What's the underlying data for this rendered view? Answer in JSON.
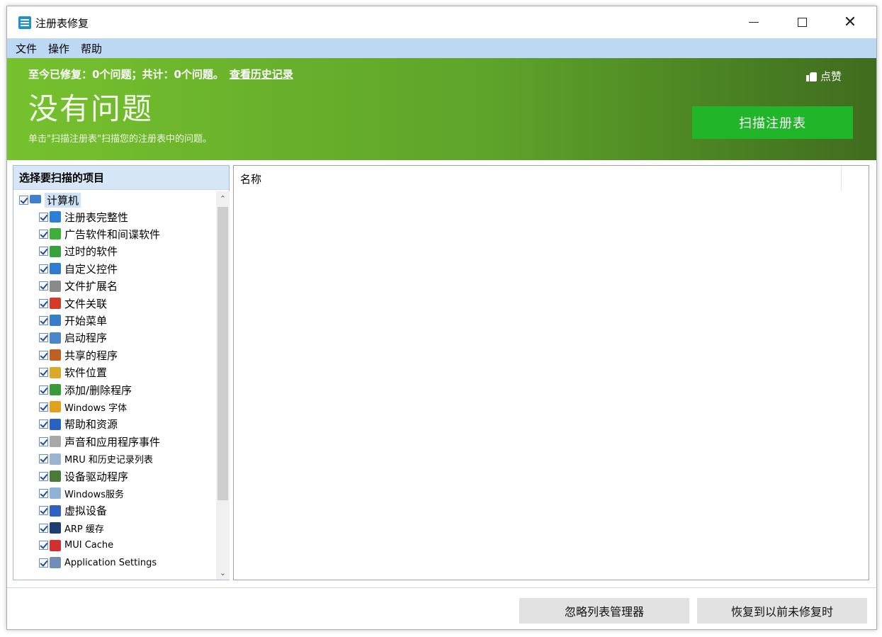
{
  "window": {
    "title": "注册表修复"
  },
  "menu": {
    "items": [
      "文件",
      "操作",
      "帮助"
    ]
  },
  "banner": {
    "stats_text": "至今已修复：0个问题；共计：0个问题。",
    "history_link": "查看历史记录",
    "title": "没有问题",
    "hint": "单击\"扫描注册表\"扫描您的注册表中的问题。",
    "like_label": "点赞",
    "scan_button": "扫描注册表",
    "colors": {
      "start": "#76c12e",
      "end": "#3f6c1e",
      "button": "#21b62a"
    }
  },
  "left_panel": {
    "header": "选择要扫描的项目",
    "root": {
      "label": "计算机",
      "icon": "computer-icon"
    },
    "items": [
      {
        "label": "注册表完整性",
        "icon": "registry-icon",
        "color": "#2d7fd3"
      },
      {
        "label": "广告软件和间谍软件",
        "icon": "shield-icon",
        "color": "#3fae3a"
      },
      {
        "label": "过时的软件",
        "icon": "recycle-bin-icon",
        "color": "#36a23c"
      },
      {
        "label": "自定义控件",
        "icon": "network-icon",
        "color": "#2f7bd0"
      },
      {
        "label": "文件扩展名",
        "icon": "file-icon",
        "color": "#8a8a8a"
      },
      {
        "label": "文件关联",
        "icon": "letter-a-icon",
        "color": "#d23a2a"
      },
      {
        "label": "开始菜单",
        "icon": "start-menu-icon",
        "color": "#3b7cc8"
      },
      {
        "label": "启动程序",
        "icon": "window-icon",
        "color": "#4a86c8"
      },
      {
        "label": "共享的程序",
        "icon": "share-icon",
        "color": "#c06020"
      },
      {
        "label": "软件位置",
        "icon": "folder-icon",
        "color": "#d8a92c"
      },
      {
        "label": "添加/删除程序",
        "icon": "program-icon",
        "color": "#3a9a3a"
      },
      {
        "label": "Windows 字体",
        "icon": "font-icon",
        "color": "#e0a020"
      },
      {
        "label": "帮助和资源",
        "icon": "help-icon",
        "color": "#2a62c4"
      },
      {
        "label": "声音和应用程序事件",
        "icon": "sound-icon",
        "color": "#a8a8a8"
      },
      {
        "label": "MRU 和历史记录列表",
        "icon": "history-icon",
        "color": "#9ab4d0"
      },
      {
        "label": "设备驱动程序",
        "icon": "chip-icon",
        "color": "#4a7a3a"
      },
      {
        "label": "Windows服务",
        "icon": "services-icon",
        "color": "#8fb2d6"
      },
      {
        "label": "虚拟设备",
        "icon": "virtual-device-icon",
        "color": "#2f62c0"
      },
      {
        "label": "ARP 缓存",
        "icon": "footprint-icon",
        "color": "#1d3d73"
      },
      {
        "label": "MUI Cache",
        "icon": "mui-icon",
        "color": "#d03030"
      },
      {
        "label": "Application Settings",
        "icon": "settings-icon",
        "color": "#6f8fb8"
      }
    ]
  },
  "right_panel": {
    "column_header": "名称"
  },
  "footer": {
    "ignore_button": "忽略列表管理器",
    "restore_button": "恢复到以前未修复时"
  }
}
